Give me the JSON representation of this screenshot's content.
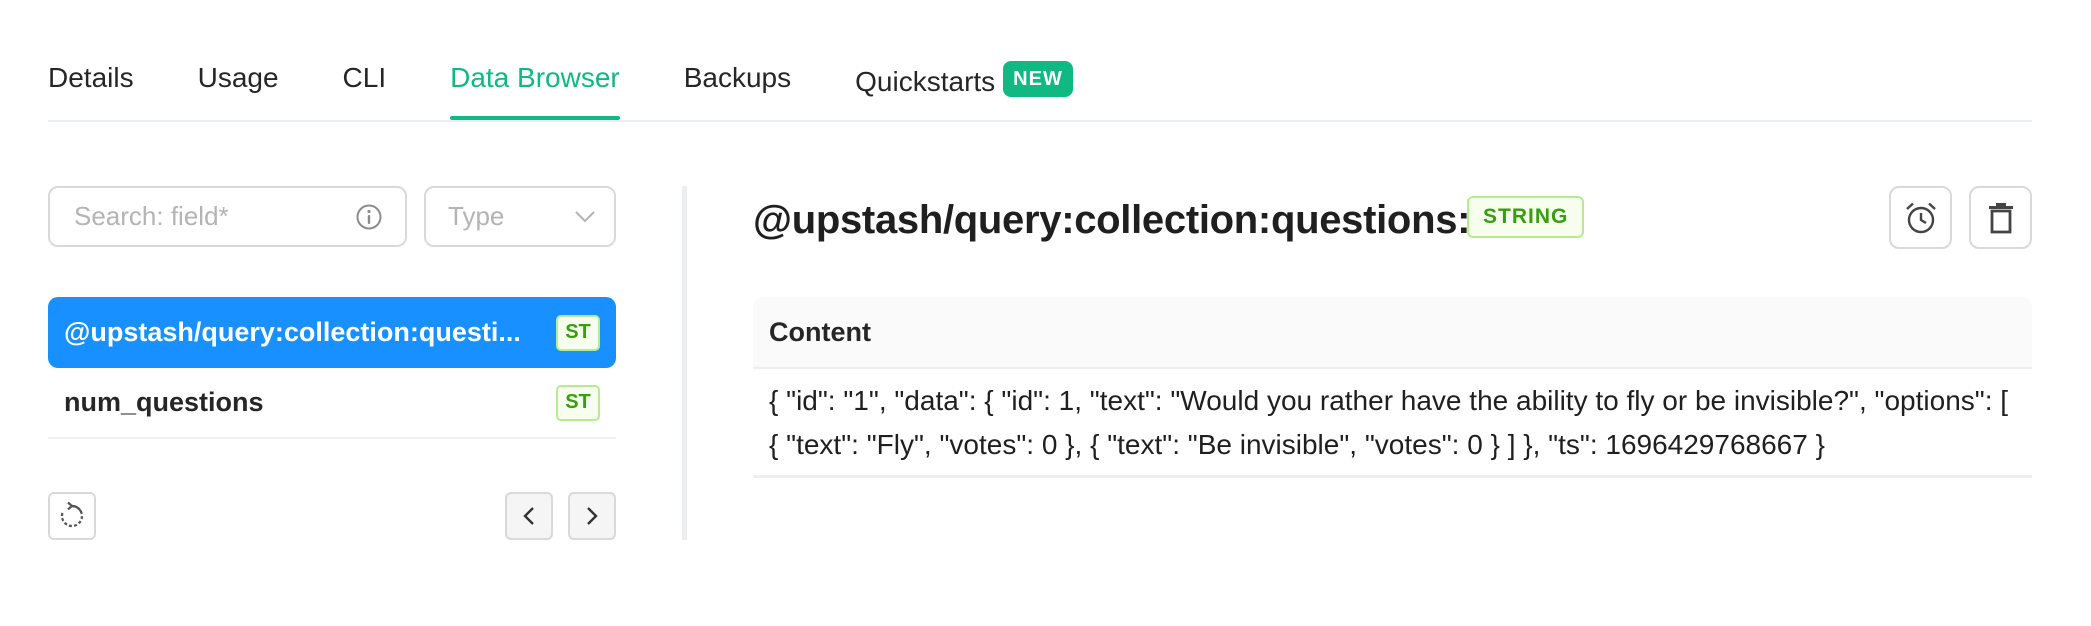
{
  "tabs": [
    {
      "label": "Details",
      "active": false
    },
    {
      "label": "Usage",
      "active": false
    },
    {
      "label": "CLI",
      "active": false
    },
    {
      "label": "Data Browser",
      "active": true
    },
    {
      "label": "Backups",
      "active": false
    },
    {
      "label": "Quickstarts",
      "active": false,
      "badge": "NEW"
    }
  ],
  "search": {
    "placeholder": "Search: field*",
    "value": ""
  },
  "type_filter": {
    "placeholder": "Type"
  },
  "keys": [
    {
      "name": "@upstash/query:collection:questi...",
      "type_tag": "ST",
      "selected": true
    },
    {
      "name": "num_questions",
      "type_tag": "ST",
      "selected": false
    }
  ],
  "detail": {
    "key": "@upstash/query:collection:questions:1",
    "type_tag": "STRING",
    "content_header": "Content",
    "content": "{ \"id\": \"1\", \"data\": { \"id\": 1, \"text\": \"Would you rather have the ability to fly or be invisible?\", \"options\": [ { \"text\": \"Fly\", \"votes\": 0 }, { \"text\": \"Be invisible\", \"votes\": 0 } ] }, \"ts\": 1696429768667 }"
  },
  "colors": {
    "accent": "#10b981",
    "selected_row": "#1890ff",
    "tag_green": "#389e0d"
  },
  "icons": [
    "info-icon",
    "chevron-down-icon",
    "refresh-icon",
    "chevron-left-icon",
    "chevron-right-icon",
    "alarm-clock-icon",
    "trash-icon"
  ]
}
